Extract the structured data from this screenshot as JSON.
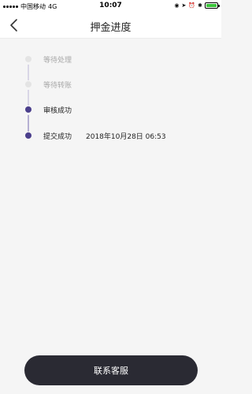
{
  "status_bar": {
    "carrier": "中国移动",
    "network": "4G",
    "time": "10:07",
    "battery_color": "#3ac43a"
  },
  "nav": {
    "back_icon": "chevron-left-icon",
    "title": "押金进度"
  },
  "timeline": {
    "steps": [
      {
        "label": "等待处理",
        "status": "pending",
        "time": ""
      },
      {
        "label": "等待转账",
        "status": "pending",
        "time": ""
      },
      {
        "label": "审核成功",
        "status": "done",
        "time": ""
      },
      {
        "label": "提交成功",
        "status": "done",
        "time": "2018年10月28日 06:53"
      }
    ],
    "colors": {
      "done": "#4b3f8c",
      "pending": "#e4e4e4"
    }
  },
  "contact_button": {
    "label": "联系客服"
  }
}
